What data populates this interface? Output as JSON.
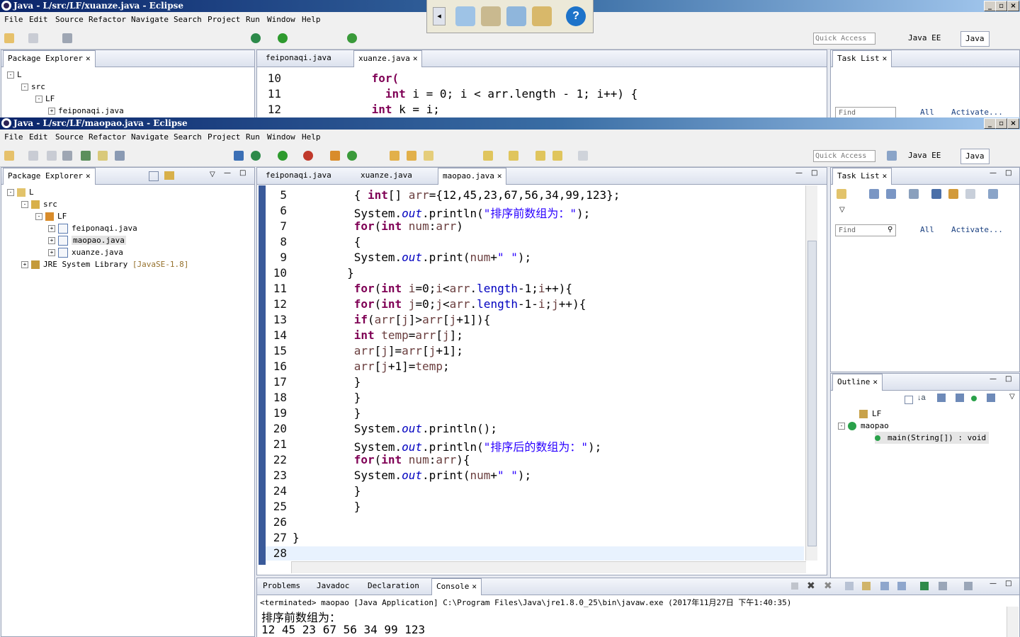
{
  "back_window": {
    "title": "Java - L/src/LF/xuanze.java - Eclipse",
    "editor_tabs": [
      "feiponaqi.java",
      "xuanze.java"
    ],
    "code_lines": [
      {
        "n": "10",
        "segments": [
          {
            "t": "            for(",
            "c": "kw"
          }
        ]
      },
      {
        "n": "11",
        "segments": [
          {
            "t": "              int",
            "c": "kw"
          },
          {
            "t": " i = 0; i < arr.length - 1; i++) {",
            "c": ""
          }
        ]
      },
      {
        "n": "12",
        "segments": [
          {
            "t": "            int",
            "c": "kw"
          },
          {
            "t": " k = i;",
            "c": ""
          }
        ]
      }
    ],
    "tree": [
      "L",
      "src",
      "LF",
      "feiponaqi.java"
    ]
  },
  "window": {
    "title": "Java - L/src/LF/maopao.java - Eclipse",
    "menu": [
      "File",
      "Edit",
      "Source",
      "Refactor",
      "Navigate",
      "Search",
      "Project",
      "Run",
      "Window",
      "Help"
    ],
    "quick_access_placeholder": "Quick Access",
    "perspectives": [
      "Java EE",
      "Java"
    ]
  },
  "package_explorer": {
    "tab": "Package Explorer",
    "tree": [
      {
        "label": "L",
        "depth": 0
      },
      {
        "label": "src",
        "depth": 1
      },
      {
        "label": "LF",
        "depth": 2
      },
      {
        "label": "feiponaqi.java",
        "depth": 3
      },
      {
        "label": "maopao.java",
        "depth": 3,
        "selected": true
      },
      {
        "label": "xuanze.java",
        "depth": 3
      },
      {
        "label": "JRE System Library",
        "suffix": "[JavaSE-1.8]",
        "depth": 1
      }
    ]
  },
  "editor": {
    "tabs": [
      "feiponaqi.java",
      "xuanze.java",
      "maopao.java"
    ],
    "active_tab": 2,
    "lines": [
      {
        "n": "5",
        "segments": [
          {
            "t": "  { ",
            "c": ""
          },
          {
            "t": "int",
            "c": "kw"
          },
          {
            "t": "[] ",
            "c": ""
          },
          {
            "t": "arr",
            "c": "var"
          },
          {
            "t": "={12,45,23,67,56,34,99,123};",
            "c": ""
          }
        ]
      },
      {
        "n": "6",
        "segments": [
          {
            "t": "  System.",
            "c": ""
          },
          {
            "t": "out",
            "c": "fld"
          },
          {
            "t": ".println(",
            "c": ""
          },
          {
            "t": "\"排序前数组为：\"",
            "c": "str"
          },
          {
            "t": ");",
            "c": ""
          }
        ]
      },
      {
        "n": "7",
        "segments": [
          {
            "t": "  ",
            "c": ""
          },
          {
            "t": "for",
            "c": "kw"
          },
          {
            "t": "(",
            "c": ""
          },
          {
            "t": "int",
            "c": "kw"
          },
          {
            "t": " ",
            "c": ""
          },
          {
            "t": "num",
            "c": "var"
          },
          {
            "t": ":",
            "c": ""
          },
          {
            "t": "arr",
            "c": "var"
          },
          {
            "t": ")",
            "c": ""
          }
        ]
      },
      {
        "n": "8",
        "segments": [
          {
            "t": "  {",
            "c": ""
          }
        ]
      },
      {
        "n": "9",
        "segments": [
          {
            "t": "  System.",
            "c": ""
          },
          {
            "t": "out",
            "c": "fld"
          },
          {
            "t": ".print(",
            "c": ""
          },
          {
            "t": "num",
            "c": "var"
          },
          {
            "t": "+",
            "c": ""
          },
          {
            "t": "\" \"",
            "c": "str"
          },
          {
            "t": ");",
            "c": ""
          }
        ]
      },
      {
        "n": "10",
        "segments": [
          {
            "t": " }",
            "c": ""
          }
        ]
      },
      {
        "n": "11",
        "segments": [
          {
            "t": " ",
            "c": ""
          },
          {
            "t": "for",
            "c": "kw"
          },
          {
            "t": "(",
            "c": ""
          },
          {
            "t": "int",
            "c": "kw"
          },
          {
            "t": " ",
            "c": ""
          },
          {
            "t": "i",
            "c": "var"
          },
          {
            "t": "=0;",
            "c": ""
          },
          {
            "t": "i",
            "c": "var"
          },
          {
            "t": "<",
            "c": ""
          },
          {
            "t": "arr",
            "c": "var"
          },
          {
            "t": ".",
            "c": ""
          },
          {
            "t": "length",
            "c": "fld2"
          },
          {
            "t": "-1;",
            "c": ""
          },
          {
            "t": "i",
            "c": "var"
          },
          {
            "t": "++){",
            "c": ""
          }
        ]
      },
      {
        "n": "12",
        "segments": [
          {
            "t": " ",
            "c": ""
          },
          {
            "t": "for",
            "c": "kw"
          },
          {
            "t": "(",
            "c": ""
          },
          {
            "t": "int",
            "c": "kw"
          },
          {
            "t": " ",
            "c": ""
          },
          {
            "t": "j",
            "c": "var"
          },
          {
            "t": "=0;",
            "c": ""
          },
          {
            "t": "j",
            "c": "var"
          },
          {
            "t": "<",
            "c": ""
          },
          {
            "t": "arr",
            "c": "var"
          },
          {
            "t": ".",
            "c": ""
          },
          {
            "t": "length",
            "c": "fld2"
          },
          {
            "t": "-1-",
            "c": ""
          },
          {
            "t": "i",
            "c": "var"
          },
          {
            "t": ";",
            "c": ""
          },
          {
            "t": "j",
            "c": "var"
          },
          {
            "t": "++){",
            "c": ""
          }
        ]
      },
      {
        "n": "13",
        "segments": [
          {
            "t": " ",
            "c": ""
          },
          {
            "t": "if",
            "c": "kw"
          },
          {
            "t": "(",
            "c": ""
          },
          {
            "t": "arr",
            "c": "var"
          },
          {
            "t": "[",
            "c": ""
          },
          {
            "t": "j",
            "c": "var"
          },
          {
            "t": "]>",
            "c": ""
          },
          {
            "t": "arr",
            "c": "var"
          },
          {
            "t": "[",
            "c": ""
          },
          {
            "t": "j",
            "c": "var"
          },
          {
            "t": "+1]){",
            "c": ""
          }
        ]
      },
      {
        "n": "14",
        "segments": [
          {
            "t": " ",
            "c": ""
          },
          {
            "t": "int",
            "c": "kw"
          },
          {
            "t": " ",
            "c": ""
          },
          {
            "t": "temp",
            "c": "var"
          },
          {
            "t": "=",
            "c": ""
          },
          {
            "t": "arr",
            "c": "var"
          },
          {
            "t": "[",
            "c": ""
          },
          {
            "t": "j",
            "c": "var"
          },
          {
            "t": "];",
            "c": ""
          }
        ]
      },
      {
        "n": "15",
        "segments": [
          {
            "t": " ",
            "c": ""
          },
          {
            "t": "arr",
            "c": "var"
          },
          {
            "t": "[",
            "c": ""
          },
          {
            "t": "j",
            "c": "var"
          },
          {
            "t": "]=",
            "c": ""
          },
          {
            "t": "arr",
            "c": "var"
          },
          {
            "t": "[",
            "c": ""
          },
          {
            "t": "j",
            "c": "var"
          },
          {
            "t": "+1];",
            "c": ""
          }
        ]
      },
      {
        "n": "16",
        "segments": [
          {
            "t": " ",
            "c": ""
          },
          {
            "t": "arr",
            "c": "var"
          },
          {
            "t": "[",
            "c": ""
          },
          {
            "t": "j",
            "c": "var"
          },
          {
            "t": "+1]=",
            "c": ""
          },
          {
            "t": "temp",
            "c": "var"
          },
          {
            "t": ";",
            "c": ""
          }
        ]
      },
      {
        "n": "17",
        "segments": [
          {
            "t": " }",
            "c": ""
          }
        ]
      },
      {
        "n": "18",
        "segments": [
          {
            "t": " }",
            "c": ""
          }
        ]
      },
      {
        "n": "19",
        "segments": [
          {
            "t": " }",
            "c": ""
          }
        ]
      },
      {
        "n": "20",
        "segments": [
          {
            "t": " System.",
            "c": ""
          },
          {
            "t": "out",
            "c": "fld"
          },
          {
            "t": ".println();",
            "c": ""
          }
        ]
      },
      {
        "n": "21",
        "segments": [
          {
            "t": " System.",
            "c": ""
          },
          {
            "t": "out",
            "c": "fld"
          },
          {
            "t": ".println(",
            "c": ""
          },
          {
            "t": "\"排序后的数组为：\"",
            "c": "str"
          },
          {
            "t": ");",
            "c": ""
          }
        ]
      },
      {
        "n": "22",
        "segments": [
          {
            "t": " ",
            "c": ""
          },
          {
            "t": "for",
            "c": "kw"
          },
          {
            "t": "(",
            "c": ""
          },
          {
            "t": "int",
            "c": "kw"
          },
          {
            "t": " ",
            "c": ""
          },
          {
            "t": "num",
            "c": "var"
          },
          {
            "t": ":",
            "c": ""
          },
          {
            "t": "arr",
            "c": "var"
          },
          {
            "t": "){",
            "c": ""
          }
        ]
      },
      {
        "n": "23",
        "segments": [
          {
            "t": " System.",
            "c": ""
          },
          {
            "t": "out",
            "c": "fld"
          },
          {
            "t": ".print(",
            "c": ""
          },
          {
            "t": "num",
            "c": "var"
          },
          {
            "t": "+",
            "c": ""
          },
          {
            "t": "\" \"",
            "c": "str"
          },
          {
            "t": ");",
            "c": ""
          }
        ]
      },
      {
        "n": "24",
        "segments": [
          {
            "t": " }",
            "c": ""
          }
        ]
      },
      {
        "n": "25",
        "segments": [
          {
            "t": " }",
            "c": ""
          }
        ]
      },
      {
        "n": "26",
        "segments": [
          {
            "t": "",
            "c": ""
          }
        ]
      },
      {
        "n": "27",
        "segments": [
          {
            "t": "}",
            "c": ""
          }
        ]
      },
      {
        "n": "28",
        "segments": [
          {
            "t": "",
            "c": ""
          }
        ]
      }
    ]
  },
  "task_list": {
    "tab": "Task List",
    "find_placeholder": "Find",
    "all_label": "All",
    "activate_label": "Activate..."
  },
  "outline": {
    "tab": "Outline",
    "items": [
      {
        "label": "LF",
        "type": "package"
      },
      {
        "label": "maopao",
        "type": "class"
      },
      {
        "label": "main(String[]) : void",
        "type": "method"
      }
    ]
  },
  "console": {
    "tabs": [
      "Problems",
      "Javadoc",
      "Declaration",
      "Console"
    ],
    "active_tab": 3,
    "status": "<terminated> maopao [Java Application] C:\\Program Files\\Java\\jre1.8.0_25\\bin\\javaw.exe (2017年11月27日 下午1:40:35)",
    "output": [
      "排序前数组为：",
      "12 45 23 67 56 34 99 123"
    ]
  },
  "colors": {
    "keyword": "#7f0055",
    "field": "#0000c0",
    "string": "#2a00ff",
    "variable": "#6a3e3e",
    "title_gradient_start": "#0a246a"
  },
  "icons": [
    "help-icon",
    "eclipse-icon",
    "run-icon",
    "debug-icon",
    "search-icon",
    "minimize-icon",
    "maximize-icon",
    "close-icon"
  ]
}
